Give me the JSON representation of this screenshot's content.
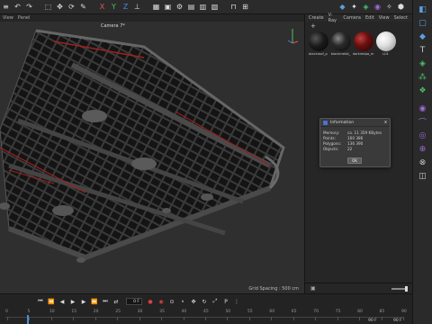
{
  "topbar": {
    "icons": [
      "menu-icon",
      "undo-icon",
      "redo-icon",
      "pen-icon",
      "x-axis",
      "y-axis",
      "z-axis",
      "lock-icon",
      "coord-icon"
    ],
    "axis_labels": {
      "x": "X",
      "y": "Y",
      "z": "Z"
    }
  },
  "viewport_menu": [
    "View",
    "Panel"
  ],
  "viewport": {
    "camera_label": "Camera 7*",
    "grid_spacing": "Grid Spacing : 500 cm"
  },
  "right_panel": {
    "menu": [
      "Create",
      "V-Ray",
      "Camera",
      "Edit",
      "View",
      "Select"
    ],
    "add_label": "+",
    "materials": [
      {
        "name": "blackroof_p",
        "color": "#1a1a1a"
      },
      {
        "name": "blackmetal_",
        "color": "#2a2a2a"
      },
      {
        "name": "darkredpa_m",
        "color": "#6a1010"
      },
      {
        "name": "LU1",
        "color": "#e8e8e8"
      }
    ]
  },
  "dialog": {
    "title": "Information",
    "close": "x",
    "rows": [
      {
        "key": "Memory:",
        "value": "ca. 11 359 KBytes"
      },
      {
        "key": "Points:",
        "value": "160 386"
      },
      {
        "key": "Polygons:",
        "value": "136 390"
      },
      {
        "key": "Objects:",
        "value": "22"
      }
    ],
    "ok_label": "OK"
  },
  "timeline": {
    "frame_field": "0 F",
    "end_frame_a": "90 F",
    "end_frame_b": "90 F",
    "ruler": [
      "0",
      "5",
      "10",
      "15",
      "20",
      "25",
      "30",
      "35",
      "40",
      "45",
      "50",
      "55",
      "60",
      "65",
      "70",
      "75",
      "80",
      "85",
      "90"
    ]
  },
  "colors": {
    "accent_blue": "#4d8fdc",
    "record_red": "#d84040",
    "tool_green": "#4fbf6a",
    "tool_purple": "#a06ad8"
  }
}
